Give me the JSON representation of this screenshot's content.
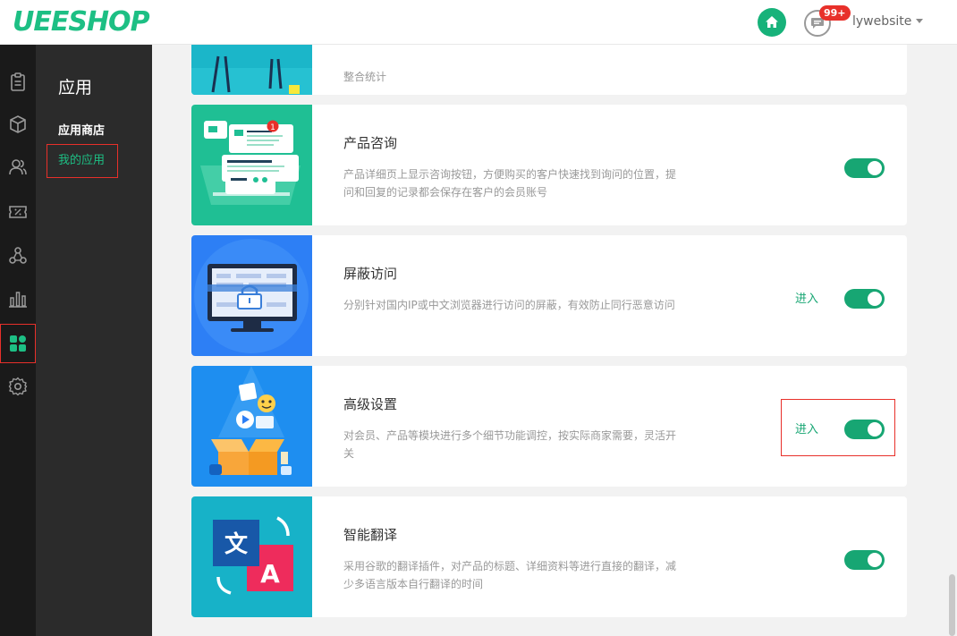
{
  "header": {
    "logo_text": "UEESHOP",
    "message_badge": "99+",
    "username": "lywebsite"
  },
  "rail": {
    "icons": [
      "clipboard-icon",
      "box-icon",
      "users-icon",
      "discount-icon",
      "network-icon",
      "bar-chart-icon",
      "apps-icon",
      "gear-icon"
    ]
  },
  "subnav": {
    "title": "应用",
    "items": [
      {
        "label": "应用商店"
      },
      {
        "label": "我的应用"
      }
    ]
  },
  "apps": [
    {
      "title": "",
      "desc": "整合统计",
      "enter": "",
      "enabled": true
    },
    {
      "title": "产品咨询",
      "desc": "产品详细页上显示咨询按钮，方便购买的客户快速找到询问的位置，提问和回复的记录都会保存在客户的会员账号",
      "enter": "",
      "enabled": true
    },
    {
      "title": "屏蔽访问",
      "desc": "分别针对国内IP或中文浏览器进行访问的屏蔽，有效防止同行恶意访问",
      "enter": "进入",
      "enabled": true
    },
    {
      "title": "高级设置",
      "desc": "对会员、产品等模块进行多个细节功能调控，按实际商家需要，灵活开关",
      "enter": "进入",
      "enabled": true
    },
    {
      "title": "智能翻译",
      "desc": "采用谷歌的翻译插件，对产品的标题、详细资料等进行直接的翻译，减少多语言版本自行翻译的时间",
      "enter": "",
      "enabled": true
    }
  ],
  "translate_thumb": {
    "char_zh": "文",
    "char_en": "A"
  },
  "consult_thumb": {
    "badge": "1"
  },
  "colors": {
    "accent": "#17a673",
    "brand": "#1dbf84",
    "alert": "#e8302a"
  }
}
